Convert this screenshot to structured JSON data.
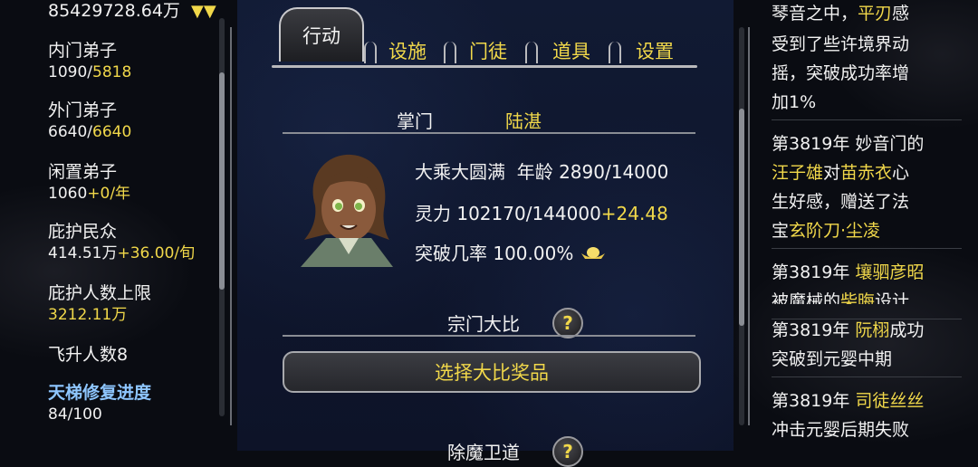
{
  "left": {
    "resource_value": "85429728.64万",
    "stats": [
      {
        "label": "内门弟子",
        "value_white": "1090/",
        "value_yellow": "5818"
      },
      {
        "label": "外门弟子",
        "value_white": "6640/",
        "value_yellow": "6640"
      },
      {
        "label": "闲置弟子",
        "value_white": "1060",
        "value_yellow": "+0/年"
      },
      {
        "label": "庇护民众",
        "value_white": "414.51万",
        "value_yellow": "+36.00/旬"
      },
      {
        "label": "庇护人数上限",
        "value_white": "",
        "value_yellow": "3212.11万"
      },
      {
        "label": "飞升人数8"
      },
      {
        "label": "天梯修复进度",
        "value_white": "84/100"
      }
    ]
  },
  "tabs": [
    {
      "label": "行动",
      "active": true
    },
    {
      "label": "设施"
    },
    {
      "label": "门徒"
    },
    {
      "label": "道具"
    },
    {
      "label": "设置"
    }
  ],
  "leader": {
    "title_label": "掌门",
    "name": "陆湛",
    "realm": "大乘大圆满",
    "age_label": "年龄",
    "age_value": "2890/14000",
    "spirit_label": "灵力",
    "spirit_value": "102170/144000",
    "spirit_rate": "+24.48",
    "breakthrough_label": "突破几率",
    "breakthrough_value": "100.00%"
  },
  "tournament": {
    "label": "宗门大比",
    "help": "?",
    "select_button": "选择大比奖品"
  },
  "next_section": {
    "label": "除魔卫道",
    "help": "?"
  },
  "log": {
    "lines": [
      [
        {
          "t": "琴音之中，"
        },
        {
          "t": "平刃",
          "c": "y"
        },
        {
          "t": "感"
        }
      ],
      [
        {
          "t": "受到了些许境界动"
        }
      ],
      [
        {
          "t": "摇，突破成功率增"
        }
      ],
      [
        {
          "t": "加1%"
        }
      ],
      [
        {
          "t": "第3819年 妙音门的"
        }
      ],
      [
        {
          "t": "汪子雄",
          "c": "y"
        },
        {
          "t": "对"
        },
        {
          "t": "苗赤衣",
          "c": "y"
        },
        {
          "t": "心"
        }
      ],
      [
        {
          "t": "生好感，赠送了法"
        }
      ],
      [
        {
          "t": "宝"
        },
        {
          "t": "玄阶刀·尘凌",
          "c": "y"
        }
      ],
      [
        {
          "t": "第3819年 "
        },
        {
          "t": "壤驷彦昭",
          "c": "y"
        }
      ],
      [
        {
          "t": "被魔械的"
        },
        {
          "t": "柴晦",
          "c": "y"
        },
        {
          "t": "设计"
        }
      ],
      [
        {
          "t": "第3819年 "
        },
        {
          "t": "阮栩",
          "c": "y"
        },
        {
          "t": "成功"
        }
      ],
      [
        {
          "t": "突破到元婴中期"
        }
      ],
      [
        {
          "t": "第3819年 "
        },
        {
          "t": "司徒丝丝",
          "c": "y"
        }
      ],
      [
        {
          "t": "冲击元婴后期失败"
        }
      ]
    ]
  },
  "colors": {
    "accent_yellow": "#f1d84a",
    "accent_blue": "#8ec6ff",
    "panel_bg": "#111a33"
  }
}
